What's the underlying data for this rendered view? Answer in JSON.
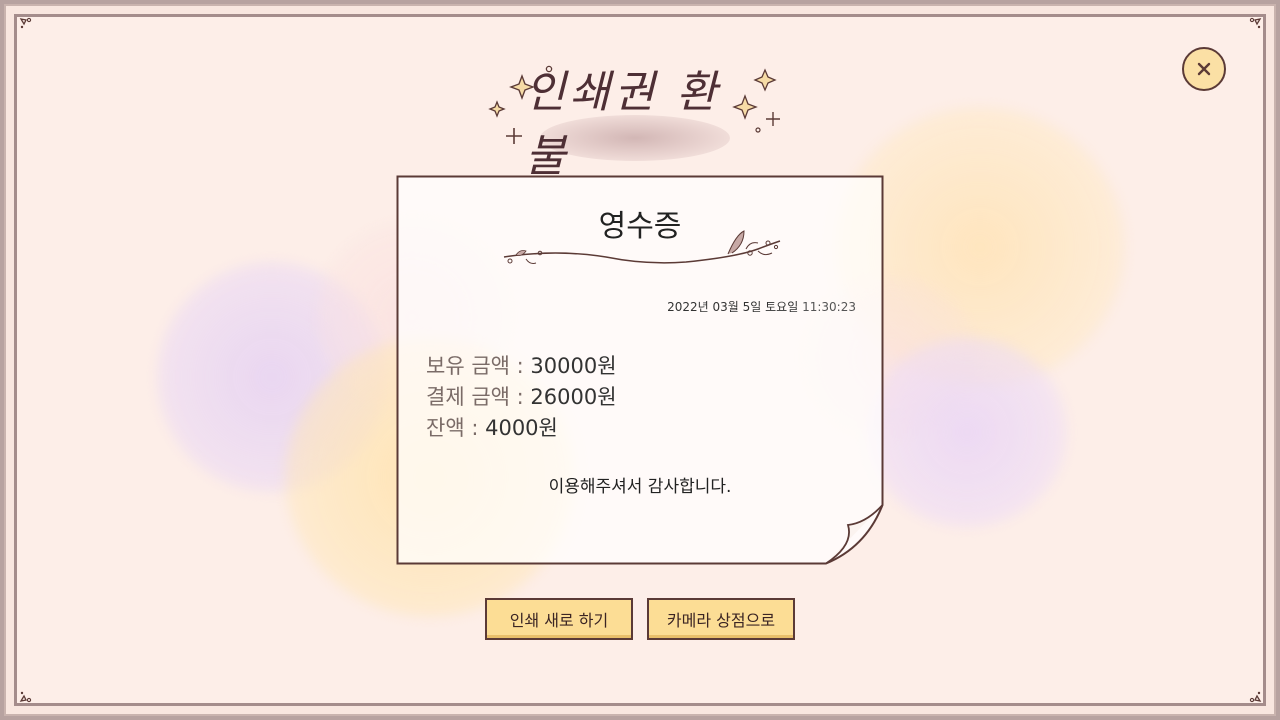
{
  "title": "인쇄권 환불",
  "receipt": {
    "heading": "영수증",
    "date": "2022년 03월 5일 토요일",
    "time": "11:30:23",
    "lines": [
      {
        "label": "보유 금액",
        "sep": ":",
        "value": "30000원"
      },
      {
        "label": "결제 금액",
        "sep": ":",
        "value": "26000원"
      },
      {
        "label": "잔액",
        "sep": ":",
        "value": "4000원"
      }
    ],
    "thanks": "이용해주셔서 감사합니다."
  },
  "buttons": {
    "reprint": "인쇄 새로 하기",
    "camera_shop": "카메라 상점으로"
  },
  "close_icon": "close-icon",
  "colors": {
    "frame_border": "#a48c8b",
    "background": "#fdeee8",
    "button_fill": "#fcdd95",
    "button_border": "#5b3a36",
    "close_fill": "#fbe0a5"
  }
}
